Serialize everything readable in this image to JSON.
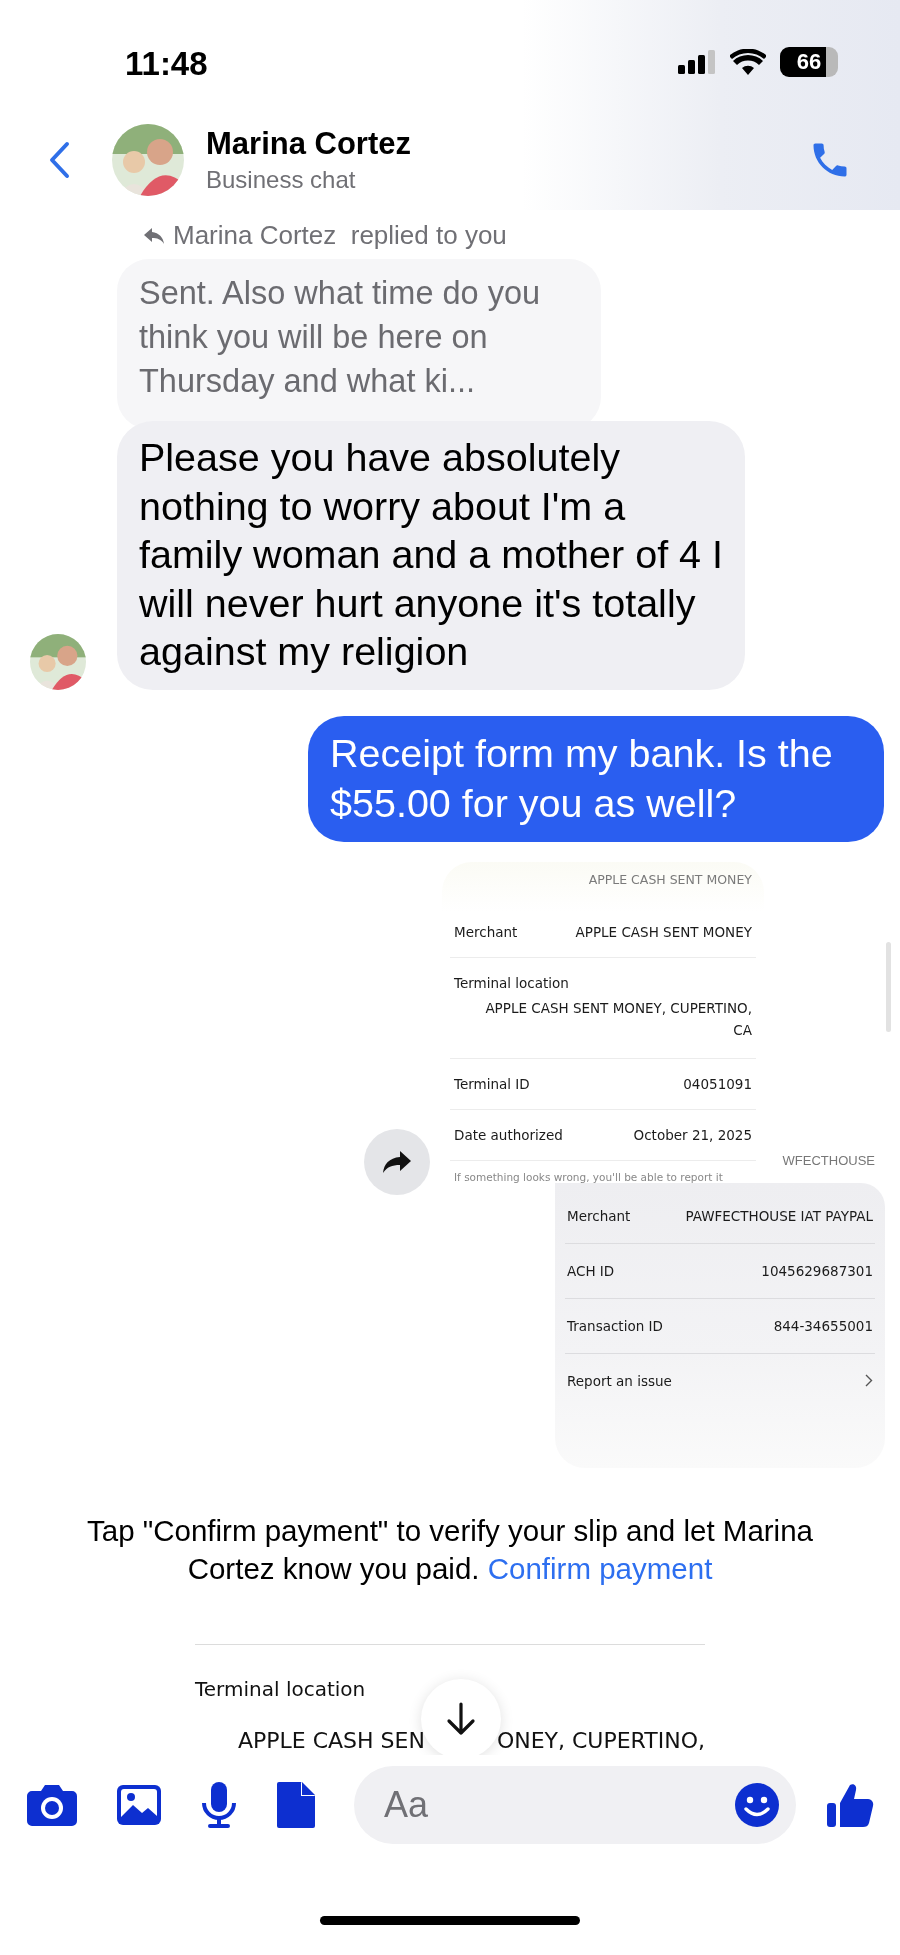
{
  "status_bar": {
    "time": "11:48",
    "battery": "66"
  },
  "header": {
    "name": "Marina Cortez",
    "subtitle": "Business chat"
  },
  "reply": {
    "label": "Marina Cortez  replied to you",
    "quoted_text": "Sent.   Also what time do you think you will be here on Thursday and what ki..."
  },
  "incoming": {
    "text": "Please you have absolutely nothing to worry about I'm a family woman and a mother of 4 I will never hurt anyone it's totally against my religion"
  },
  "outgoing": {
    "text": "Receipt form my bank.  Is the $55.00 for you as well?"
  },
  "receipts": [
    {
      "header": "APPLE CASH SENT MONEY",
      "footer": "If something looks wrong, you'll be able to report it",
      "rows": [
        {
          "kind": "pair",
          "label": "Merchant",
          "value": "APPLE CASH SENT MONEY"
        },
        {
          "kind": "stacked",
          "label": "Terminal location",
          "value": "APPLE CASH SENT MONEY, CUPERTINO, CA"
        },
        {
          "kind": "pair",
          "label": "Terminal ID",
          "value": "04051091"
        },
        {
          "kind": "pair",
          "label": "Date authorized",
          "value": "October 21, 2025"
        }
      ]
    },
    {
      "header": "WFECTHOUSE",
      "rows": [
        {
          "kind": "pair",
          "label": "Merchant",
          "value": "PAWFECTHOUSE IAT PAYPAL"
        },
        {
          "kind": "pair",
          "label": "ACH ID",
          "value": "1045629687301"
        },
        {
          "kind": "pair",
          "label": "Transaction ID",
          "value": "844-34655001"
        },
        {
          "kind": "link",
          "label": "Report an issue"
        }
      ]
    }
  ],
  "confirm_notice": {
    "text": "Tap \"Confirm payment\" to verify your slip and let Marina Cortez know you paid.",
    "link": "Confirm payment"
  },
  "preview": {
    "label": "Terminal location",
    "value_parts": [
      "APPLE CASH SEN",
      "ONEY, CUPERTINO,"
    ]
  },
  "composer": {
    "placeholder": "Aa"
  }
}
